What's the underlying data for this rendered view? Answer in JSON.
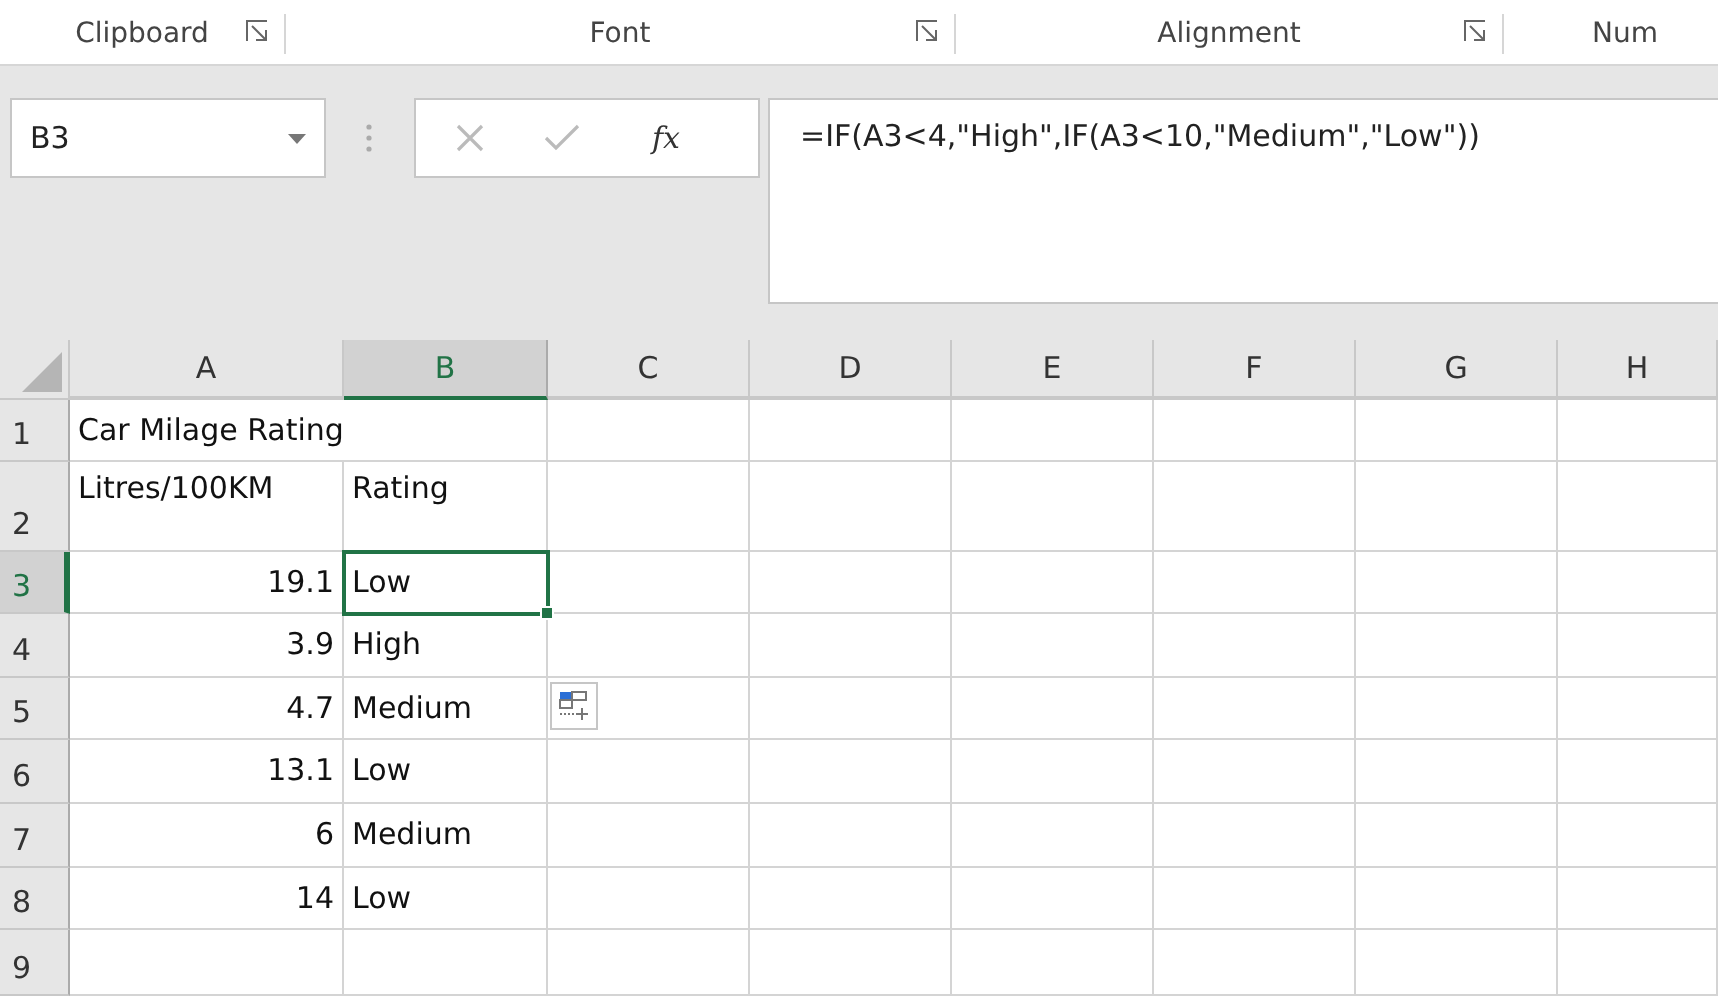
{
  "ribbon_groups": [
    {
      "label": "Clipboard",
      "launcher": true
    },
    {
      "label": "Font",
      "launcher": true
    },
    {
      "label": "Alignment",
      "launcher": true
    },
    {
      "label": "Num",
      "launcher": false
    }
  ],
  "formula_bar": {
    "name_box": "B3",
    "cancel_disabled": true,
    "enter_disabled": true,
    "insert_function": "fx",
    "formula": "=IF(A3<4,\"High\",IF(A3<10,\"Medium\",\"Low\"))"
  },
  "columns": [
    {
      "label": "A",
      "selected": false
    },
    {
      "label": "B",
      "selected": true
    },
    {
      "label": "C",
      "selected": false
    },
    {
      "label": "D",
      "selected": false
    },
    {
      "label": "E",
      "selected": false
    },
    {
      "label": "F",
      "selected": false
    },
    {
      "label": "G",
      "selected": false
    },
    {
      "label": "H",
      "selected": false
    }
  ],
  "rows": [
    {
      "number": "1",
      "selected": false,
      "cells": [
        {
          "text": "Car Milage Rating",
          "kind": "text",
          "selected": false
        }
      ]
    },
    {
      "number": "2",
      "selected": false,
      "cells": [
        {
          "text": "Litres/100KM",
          "kind": "text",
          "selected": false
        },
        {
          "text": "Rating",
          "kind": "text",
          "selected": false
        }
      ]
    },
    {
      "number": "3",
      "selected": true,
      "cells": [
        {
          "text": "19.1",
          "kind": "number",
          "selected": false
        },
        {
          "text": "Low",
          "kind": "text",
          "selected": true
        }
      ]
    },
    {
      "number": "4",
      "selected": false,
      "cells": [
        {
          "text": "3.9",
          "kind": "number",
          "selected": false
        },
        {
          "text": "High",
          "kind": "text",
          "selected": false
        }
      ]
    },
    {
      "number": "5",
      "selected": false,
      "cells": [
        {
          "text": "4.7",
          "kind": "number",
          "selected": false
        },
        {
          "text": "Medium",
          "kind": "text",
          "selected": false
        }
      ]
    },
    {
      "number": "6",
      "selected": false,
      "cells": [
        {
          "text": "13.1",
          "kind": "number",
          "selected": false
        },
        {
          "text": "Low",
          "kind": "text",
          "selected": false
        }
      ]
    },
    {
      "number": "7",
      "selected": false,
      "cells": [
        {
          "text": "6",
          "kind": "number",
          "selected": false
        },
        {
          "text": "Medium",
          "kind": "text",
          "selected": false
        }
      ]
    },
    {
      "number": "8",
      "selected": false,
      "cells": [
        {
          "text": "14",
          "kind": "number",
          "selected": false
        },
        {
          "text": "Low",
          "kind": "text",
          "selected": false
        }
      ]
    },
    {
      "number": "9",
      "selected": false,
      "cells": []
    }
  ]
}
